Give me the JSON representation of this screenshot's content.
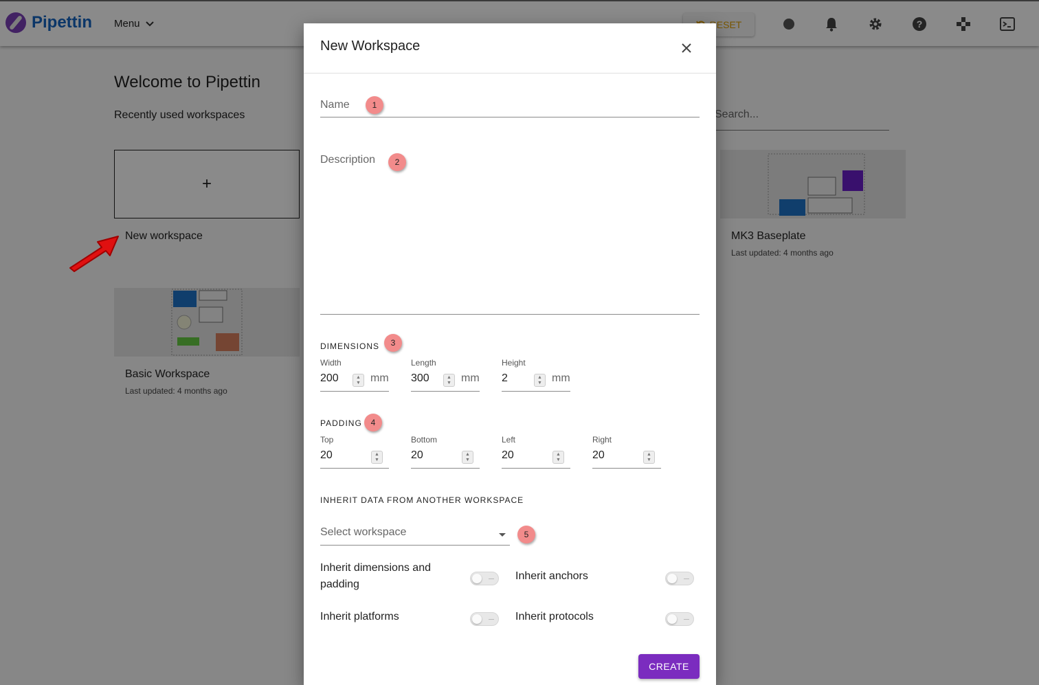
{
  "app": {
    "name": "Pipettin",
    "menu_label": "Menu",
    "reset_label": "RESET"
  },
  "home": {
    "welcome": "Welcome to Pipettin",
    "recent_label": "Recently used workspaces",
    "search_placeholder": "Search...",
    "new_card_symbol": "+",
    "new_card_label": "New workspace",
    "workspaces": [
      {
        "title": "MK3 Baseplate",
        "updated": "Last updated: 4 months ago"
      },
      {
        "title": "Basic Workspace",
        "updated": "Last updated: 4 months ago"
      }
    ]
  },
  "dialog": {
    "title": "New Workspace",
    "name_label": "Name",
    "description_label": "Description",
    "dimensions": {
      "title": "DIMENSIONS",
      "fields": [
        {
          "label": "Width",
          "value": "200",
          "unit": "mm"
        },
        {
          "label": "Length",
          "value": "300",
          "unit": "mm"
        },
        {
          "label": "Height",
          "value": "2",
          "unit": "mm"
        }
      ]
    },
    "padding": {
      "title": "PADDING",
      "fields": [
        {
          "label": "Top",
          "value": "20"
        },
        {
          "label": "Bottom",
          "value": "20"
        },
        {
          "label": "Left",
          "value": "20"
        },
        {
          "label": "Right",
          "value": "20"
        }
      ]
    },
    "inherit": {
      "title": "INHERIT DATA FROM ANOTHER WORKSPACE",
      "select_placeholder": "Select workspace",
      "dims_line1": "Inherit dimensions and",
      "dims_line2": "padding",
      "anchors": "Inherit anchors",
      "platforms": "Inherit platforms",
      "protocols": "Inherit protocols",
      "toggles_on": [
        false,
        false,
        false,
        false
      ]
    },
    "create_label": "CREATE"
  },
  "badges": [
    "1",
    "2",
    "3",
    "4",
    "5"
  ],
  "colors": {
    "brand": "#7b2cbf",
    "logo_text": "#1565c0",
    "badge": "#f28b8b",
    "reset": "#e0a000"
  }
}
